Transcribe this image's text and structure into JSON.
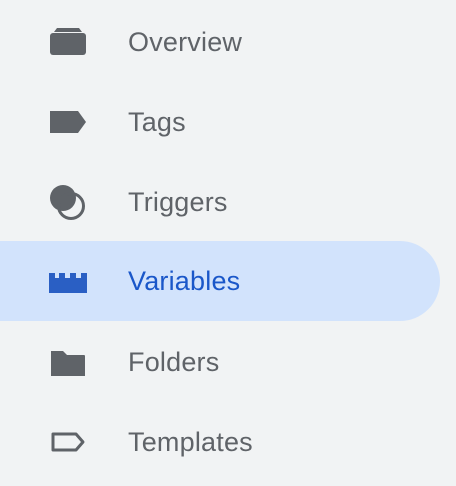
{
  "sidebar": {
    "colors": {
      "background": "#f1f3f4",
      "icon": "#5f6368",
      "text": "#5f6368",
      "active_background": "#d2e3fc",
      "active_text": "#1a57c9",
      "active_icon": "#2a5fc4"
    },
    "items": [
      {
        "label": "Overview",
        "icon": "overview-icon",
        "active": false
      },
      {
        "label": "Tags",
        "icon": "tag-icon",
        "active": false
      },
      {
        "label": "Triggers",
        "icon": "trigger-icon",
        "active": false
      },
      {
        "label": "Variables",
        "icon": "variables-icon",
        "active": true
      },
      {
        "label": "Folders",
        "icon": "folder-icon",
        "active": false
      },
      {
        "label": "Templates",
        "icon": "template-icon",
        "active": false
      }
    ]
  }
}
